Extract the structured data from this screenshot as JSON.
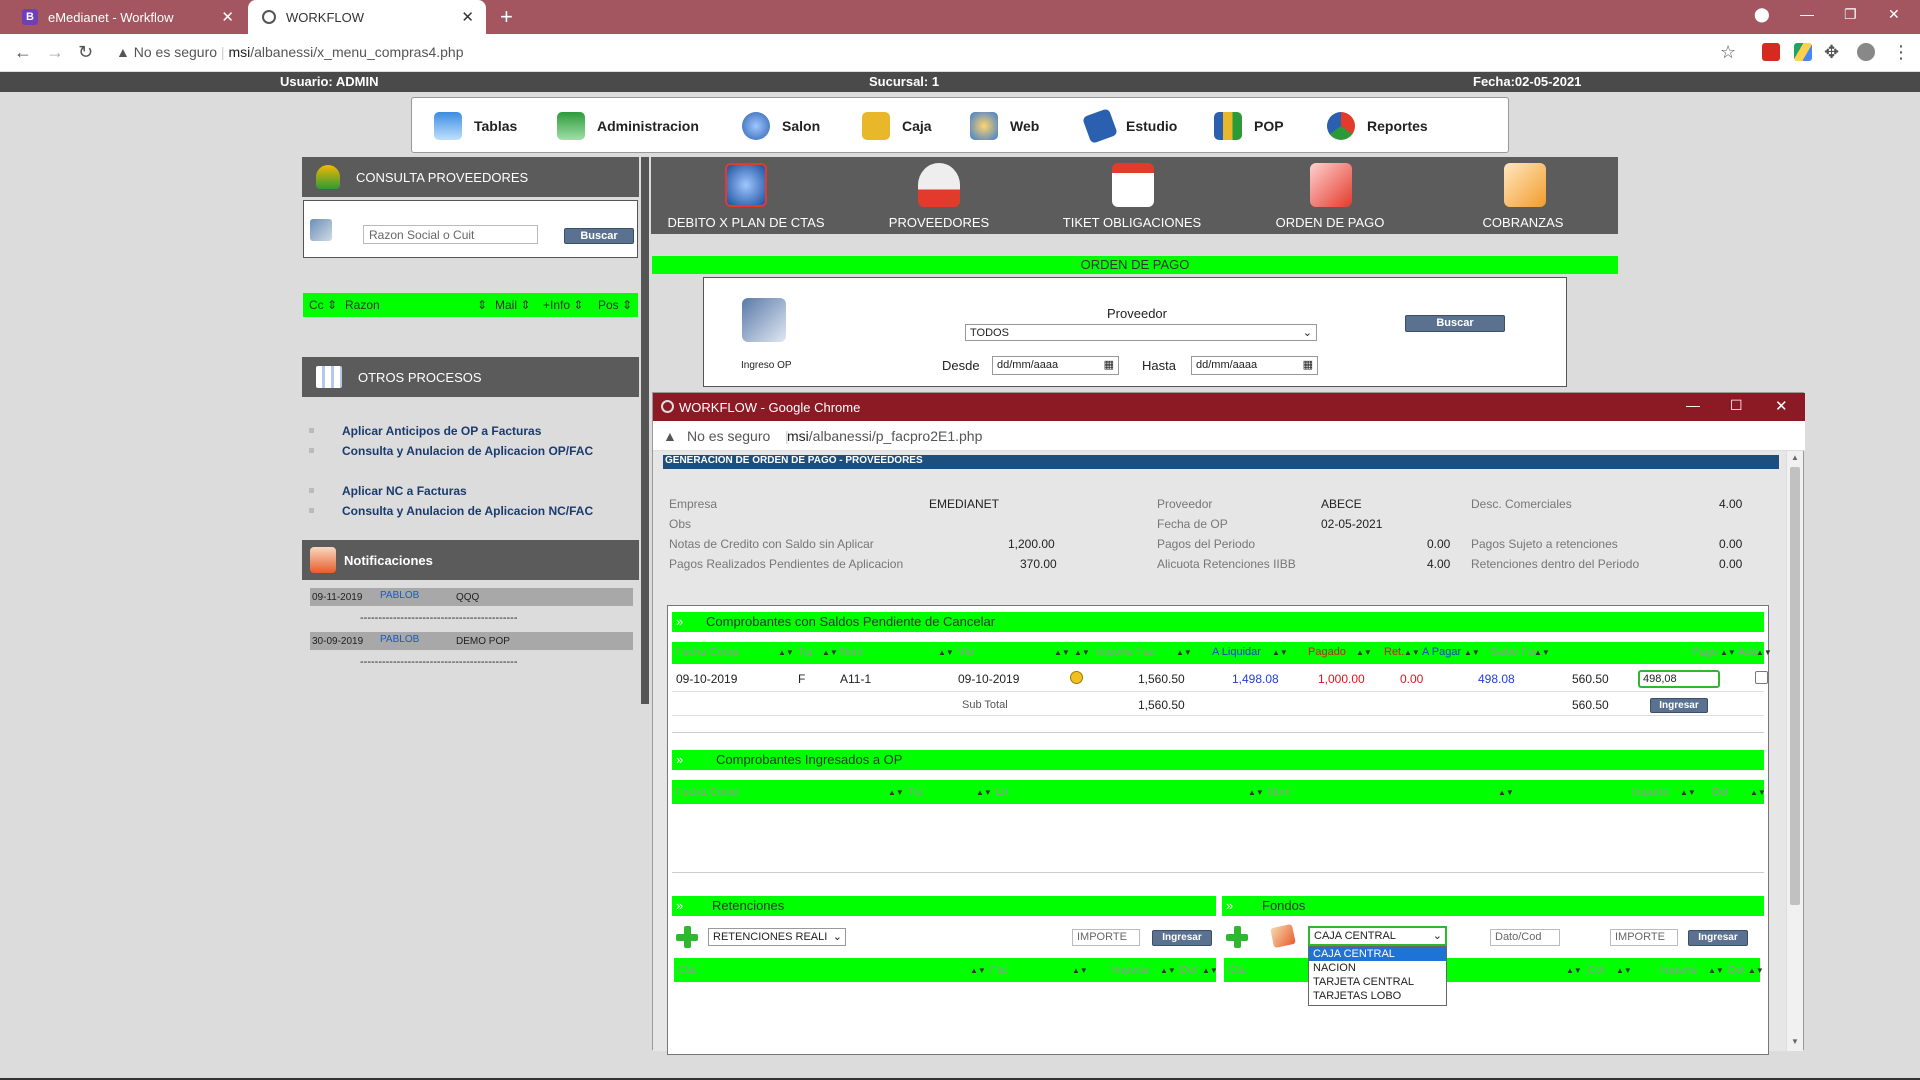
{
  "browser": {
    "tabs": [
      {
        "label": "eMedianet - Workflow",
        "icon": "bootstrap-icon"
      },
      {
        "label": "WORKFLOW",
        "icon": "globe-icon"
      }
    ],
    "security": "No es seguro",
    "url_host": "msi",
    "url_path": "/albanessi/x_menu_compras4.php"
  },
  "userbar": {
    "user": "Usuario: ADMIN",
    "branch": "Sucursal: 1",
    "date": "Fecha:02-05-2021"
  },
  "menu": [
    "Tablas",
    "Administracion",
    "Salon",
    "Caja",
    "Web",
    "Estudio",
    "POP",
    "Reportes"
  ],
  "left": {
    "consulta_title": "CONSULTA PROVEEDORES",
    "search_placeholder": "Razon Social o Cuit",
    "search_button": "Buscar",
    "list_cols": [
      "Cc",
      "Razon",
      "Mail",
      "+Info",
      "Pos"
    ],
    "otros_title": "OTROS PROCESOS",
    "links": [
      "Aplicar Anticipos de OP a Facturas",
      "Consulta y Anulacion de Aplicacion OP/FAC",
      "Aplicar NC a Facturas",
      "Consulta y Anulacion de Aplicacion NC/FAC"
    ],
    "notif_title": "Notificaciones",
    "notifications": [
      {
        "date": "09-11-2019",
        "user": "PABLOB",
        "text": "QQQ"
      },
      {
        "date": "30-09-2019",
        "user": "PABLOB",
        "text": "DEMO POP"
      }
    ],
    "separator": "-------------------------------------------"
  },
  "top_actions": [
    "DEBITO X PLAN DE CTAS",
    "PROVEEDORES",
    "TIKET OBLIGACIONES",
    "ORDEN DE PAGO",
    "COBRANZAS"
  ],
  "orden": {
    "title": "ORDEN DE PAGO",
    "icon_label": "Ingreso OP",
    "proveedor_label": "Proveedor",
    "proveedor_value": "TODOS",
    "desde_label": "Desde",
    "hasta_label": "Hasta",
    "date_placeholder": "dd/mm/aaaa",
    "buscar": "Buscar"
  },
  "popup": {
    "title": "WORKFLOW - Google Chrome",
    "security": "No es seguro",
    "url_host": "msi",
    "url_path": "/albanessi/p_facpro2E1.php",
    "header": "GENERACION DE ORDEN DE PAGO - PROVEEDORES",
    "info": {
      "empresa_lbl": "Empresa",
      "empresa_val": "EMEDIANET",
      "proveedor_lbl": "Proveedor",
      "proveedor_val": "ABECE",
      "desc_lbl": "Desc. Comerciales",
      "desc_val": "4.00",
      "obs_lbl": "Obs",
      "fecha_lbl": "Fecha de OP",
      "fecha_val": "02-05-2021",
      "notas_lbl": "Notas de Credito con Saldo sin Aplicar",
      "notas_val": "1,200.00",
      "pagos_periodo_lbl": "Pagos del Periodo",
      "pagos_periodo_val": "0.00",
      "pagos_suj_lbl": "Pagos Sujeto a retenciones",
      "pagos_suj_val": "0.00",
      "pend_lbl": "Pagos Realizados Pendientes de Aplicacion",
      "pend_val": "370.00",
      "alic_lbl": "Alicuota Retenciones IIBB",
      "alic_val": "4.00",
      "ret_lbl": "Retenciones dentro del Periodo",
      "ret_val": "0.00"
    },
    "pend_title": "Comprobantes con Saldos Pendiente de Cancelar",
    "pend_cols": [
      "Fecha Comp",
      "Tip",
      "Num",
      "Vto",
      "",
      "Importe Fac.",
      "A Liquidar",
      "Pagado",
      "Ret.",
      "A Pagar",
      "Saldo Fac.",
      "Pago",
      "Add"
    ],
    "pend_row": {
      "fecha": "09-10-2019",
      "tip": "F",
      "num": "A11-1",
      "vto": "09-10-2019",
      "importe": "1,560.50",
      "liquidar": "1,498.08",
      "pagado": "1,000.00",
      "ret": "0.00",
      "apagar": "498.08",
      "saldo": "560.50",
      "pago": "498,08"
    },
    "subtotal_label": "Sub Total",
    "subtotal_importe": "1,560.50",
    "subtotal_saldo": "560.50",
    "ingresar": "Ingresar",
    "ingresados_title": "Comprobantes Ingresados a OP",
    "ingresados_cols": [
      "Fecha Comp",
      "Tip",
      "Ltr",
      "Num",
      "Importe",
      "Del"
    ],
    "retenciones_title": "Retenciones",
    "retenciones_select": "RETENCIONES REALI",
    "importe_placeholder": "IMPORTE",
    "ret_cols": [
      "Cta",
      "Fac",
      "Importe",
      "Del"
    ],
    "fondos_title": "Fondos",
    "fondos_select": "CAJA CENTRAL",
    "fondos_options": [
      "CAJA CENTRAL",
      "NACION",
      "TARJETA CENTRAL",
      "TARJETAS LOBO"
    ],
    "dato_placeholder": "Dato/Cod",
    "fondos_cols": [
      "Cta",
      "Cot",
      "Importe",
      "Del"
    ]
  },
  "colors": {
    "green": "#00ff00",
    "tabbar": "#a35660",
    "popup_title": "#8b1a24",
    "blue_link": "#1a3b6e",
    "pagado": "#e0141e",
    "liquidar": "#1f3fd6"
  }
}
